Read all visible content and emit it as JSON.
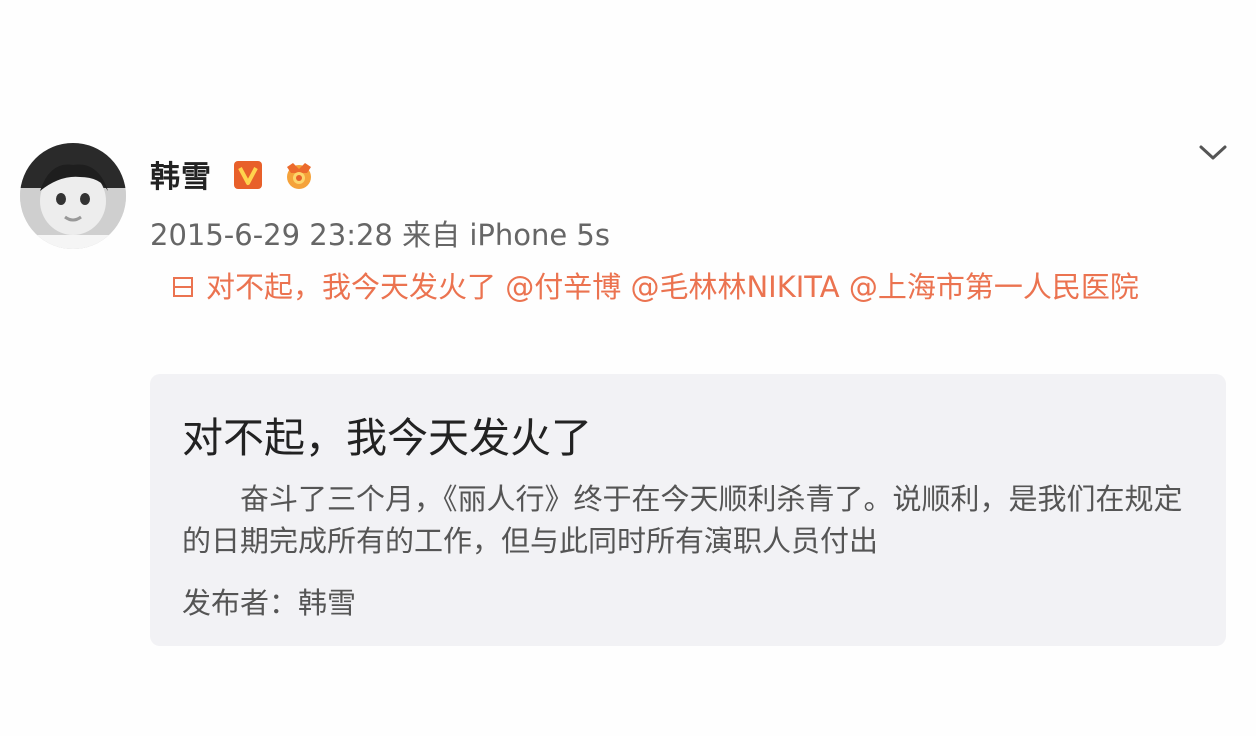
{
  "post": {
    "user_name": "韩雪",
    "timestamp": "2015-6-29 23:28",
    "source_prefix": "来自",
    "source_device": "iPhone 5s",
    "text_main": "对不起，我今天发火了",
    "mentions": [
      "@付辛博",
      "@毛林林NIKITA",
      "@上海市第一人民医院"
    ],
    "link_icon": "article-icon",
    "verified_icon": "verified-v-icon",
    "medal_icon": "member-medal-icon",
    "more_icon": "chevron-down-icon"
  },
  "card": {
    "title": "对不起，我今天发火了",
    "excerpt": "奋斗了三个月，《丽人行》终于在今天顺利杀青了。说顺利，是我们在规定的日期完成所有的工作，但与此同时所有演职人员付出",
    "author_label": "发布者：",
    "author_name": "韩雪"
  },
  "colors": {
    "link": "#eb7350",
    "verified": "#e8602a",
    "card_bg": "#f2f2f5"
  }
}
